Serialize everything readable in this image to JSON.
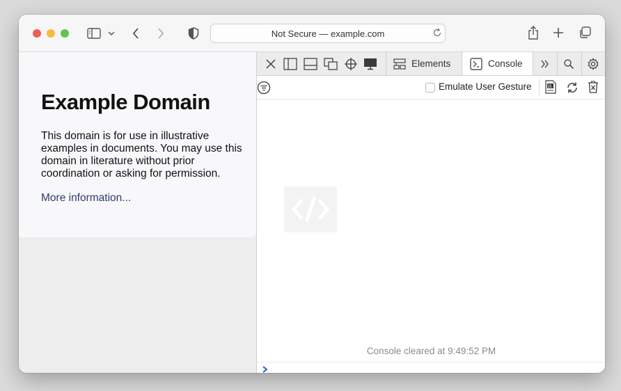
{
  "browser": {
    "address_bar": "Not Secure — example.com",
    "traffic_lights": {
      "close": "#ec5e57",
      "minimize": "#f2bd3e",
      "zoom": "#5fc453"
    },
    "toolbar_icons": [
      "sidebar-icon",
      "chevron-down-icon",
      "back-icon",
      "forward-icon",
      "shield-icon",
      "reload-icon",
      "share-icon",
      "new-tab-icon",
      "tab-overview-icon"
    ]
  },
  "page": {
    "heading": "Example Domain",
    "body": "This domain is for use in illustrative examples in documents. You may use this domain in literature without prior coordination or asking for permission.",
    "link": "More information...",
    "link_color": "#2f3c6d"
  },
  "devtools": {
    "tabs": {
      "elements": "Elements",
      "console": "Console"
    },
    "active_tab": "Console",
    "emulate_label": "Emulate User Gesture",
    "emulate_checked": false,
    "console_message": "Console cleared at 9:49:52 PM",
    "prompt_color": "#1e6ad6",
    "icons": [
      "close-icon",
      "dock-left-icon",
      "dock-bottom-icon",
      "undock-icon",
      "target-icon",
      "device-icon",
      "overflow-icon",
      "search-icon",
      "settings-icon",
      "filter-icon",
      "js-source-icon",
      "reload-icon",
      "clear-console-icon"
    ]
  }
}
